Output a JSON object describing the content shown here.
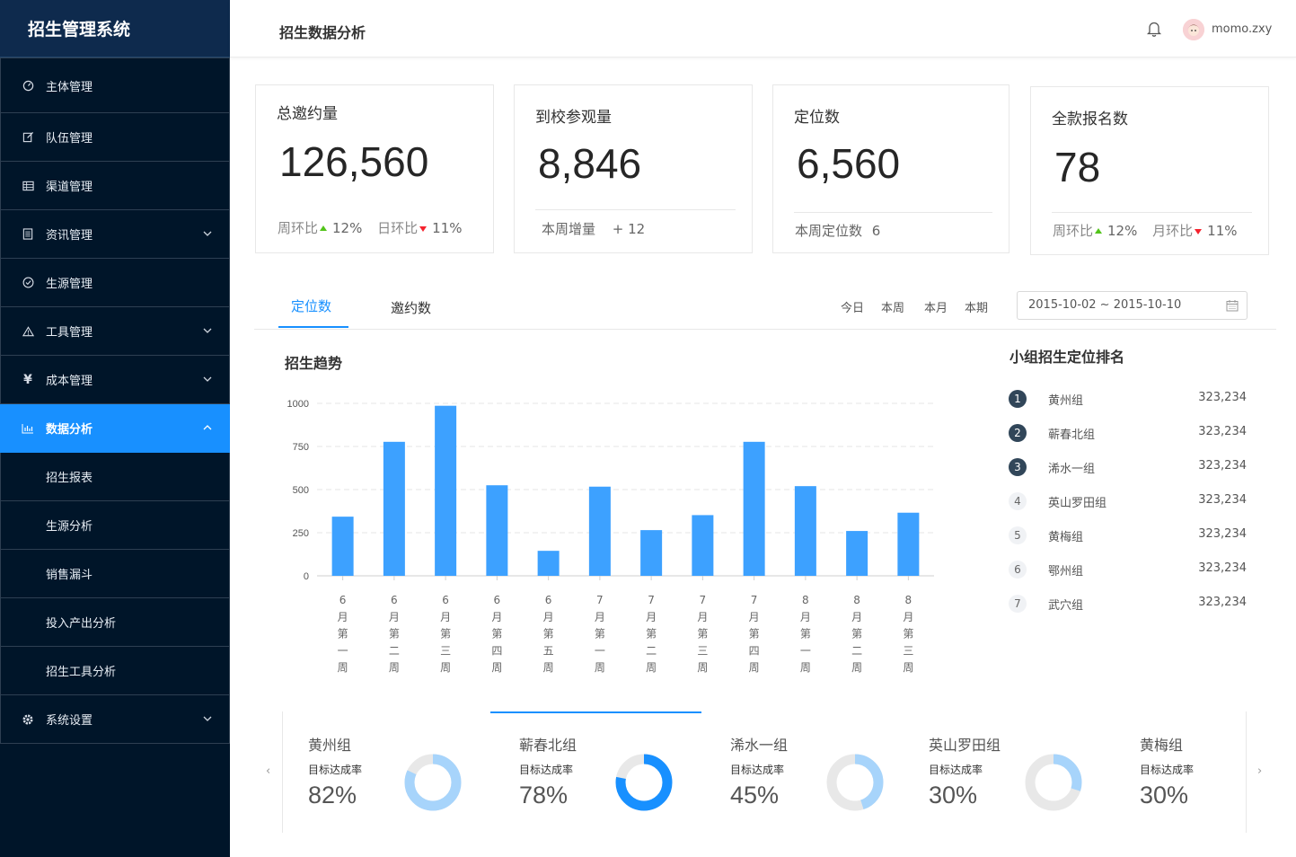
{
  "app": {
    "title": "招生管理系统"
  },
  "sidebar": {
    "items": [
      {
        "label": "主体管理",
        "icon": "dashboard-icon"
      },
      {
        "label": "队伍管理",
        "icon": "edit-icon"
      },
      {
        "label": "渠道管理",
        "icon": "table-icon"
      },
      {
        "label": "资讯管理",
        "icon": "file-icon"
      },
      {
        "label": "生源管理",
        "icon": "check-circle-icon"
      },
      {
        "label": "工具管理",
        "icon": "warning-icon"
      },
      {
        "label": "成本管理",
        "icon": "yen-icon"
      },
      {
        "label": "数据分析",
        "icon": "bar-chart-icon"
      },
      {
        "label": "招生报表"
      },
      {
        "label": "生源分析"
      },
      {
        "label": "销售漏斗"
      },
      {
        "label": "投入产出分析"
      },
      {
        "label": "招生工具分析"
      },
      {
        "label": "系统设置",
        "icon": "gear-icon"
      }
    ]
  },
  "header": {
    "title": "招生数据分析",
    "username": "momo.zxy"
  },
  "stats": [
    {
      "title": "总邀约量",
      "value": "126,560",
      "foot": [
        {
          "label": "周环比",
          "trend": "up",
          "value": "12%"
        },
        {
          "label": "日环比",
          "trend": "down",
          "value": "11%"
        }
      ]
    },
    {
      "title": "到校参观量",
      "value": "8,846",
      "foot_label": "本周增量",
      "foot_value": "+ 12"
    },
    {
      "title": "定位数",
      "value": "6,560",
      "foot_label": "本周定位数",
      "foot_value": "6"
    },
    {
      "title": "全款报名数",
      "value": "78",
      "foot": [
        {
          "label": "周环比",
          "trend": "up",
          "value": "12%"
        },
        {
          "label": "月环比",
          "trend": "down",
          "value": "11%"
        }
      ]
    }
  ],
  "tabs": [
    "定位数",
    "邀约数"
  ],
  "periods": [
    "今日",
    "本周",
    "本月",
    "本期"
  ],
  "date_range": "2015-10-02 ~ 2015-10-10",
  "chart_title": "招生趋势",
  "chart_data": {
    "type": "bar",
    "title": "招生趋势",
    "categories": [
      "6月第一周",
      "6月第二周",
      "6月第三周",
      "6月第四周",
      "6月第五周",
      "7月第一周",
      "7月第二周",
      "7月第三周",
      "7月第四周",
      "8月第一周",
      "8月第二周",
      "8月第三周"
    ],
    "values": [
      343,
      777,
      986,
      525,
      145,
      517,
      265,
      352,
      777,
      520,
      260,
      366
    ],
    "ylim": [
      0,
      1000
    ],
    "yticks": [
      0,
      250,
      500,
      750,
      1000
    ],
    "color": "#3da1ff",
    "grid": true
  },
  "ranking": {
    "title": "小组招生定位排名",
    "items": [
      {
        "rank": "1",
        "name": "黄州组",
        "value": "323,234"
      },
      {
        "rank": "2",
        "name": "蕲春北组",
        "value": "323,234"
      },
      {
        "rank": "3",
        "name": "浠水一组",
        "value": "323,234"
      },
      {
        "rank": "4",
        "name": "英山罗田组",
        "value": "323,234"
      },
      {
        "rank": "5",
        "name": "黄梅组",
        "value": "323,234"
      },
      {
        "rank": "6",
        "name": "鄂州组",
        "value": "323,234"
      },
      {
        "rank": "7",
        "name": "武穴组",
        "value": "323,234"
      }
    ]
  },
  "groups": {
    "label": "目标达成率",
    "items": [
      {
        "name": "黄州组",
        "rate": "82%",
        "fraction": 0.82,
        "color": "#a7d4fb"
      },
      {
        "name": "蕲春北组",
        "rate": "78%",
        "fraction": 0.78,
        "color": "#1890ff"
      },
      {
        "name": "浠水一组",
        "rate": "45%",
        "fraction": 0.45,
        "color": "#a7d4fb"
      },
      {
        "name": "英山罗田组",
        "rate": "30%",
        "fraction": 0.3,
        "color": "#a7d4fb"
      },
      {
        "name": "黄梅组",
        "rate": "30%",
        "fraction": 0.3,
        "color": "#a7d4fb"
      }
    ]
  },
  "colors": {
    "accent": "#1890ff",
    "sidebar": "#001529"
  }
}
